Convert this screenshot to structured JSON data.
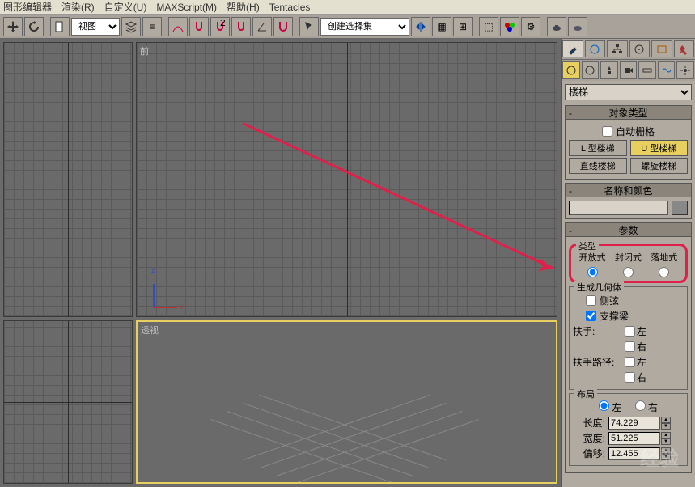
{
  "menu": {
    "items": [
      "图形编辑器",
      "渲染(R)",
      "自定义(U)",
      "MAXScript(M)",
      "帮助(H)",
      "Tentacles"
    ]
  },
  "toolbar": {
    "viewsel_label": "视图",
    "named_sel_label": "创建选择集"
  },
  "viewports": {
    "tl_label": "",
    "tr_label": "前",
    "bl_label": "",
    "br_label": "透视"
  },
  "panel": {
    "category": "楼梯",
    "rollout_objtype": "对象类型",
    "autogrid": "自动栅格",
    "stair_l": "L 型楼梯",
    "stair_u": "U 型楼梯",
    "stair_straight": "直线楼梯",
    "stair_spiral": "螺旋楼梯",
    "rollout_namecolor": "名称和颜色",
    "name_value": "",
    "rollout_params": "参数",
    "grp_type": "类型",
    "type_open": "开放式",
    "type_closed": "封闭式",
    "type_box": "落地式",
    "grp_gengeo": "生成几何体",
    "opt_stringers": "侧弦",
    "opt_carriage": "支撑梁",
    "opt_handrail": "扶手:",
    "opt_railpath": "扶手路径:",
    "side_left": "左",
    "side_right": "右",
    "grp_layout": "布局",
    "layout_left": "左",
    "layout_right": "右",
    "dim_len1": "长度:",
    "dim_len2": "宽度:",
    "dim_width": "偏移:",
    "val_len1": "74.229",
    "val_len2": "51.225",
    "val_width": "12.455"
  }
}
